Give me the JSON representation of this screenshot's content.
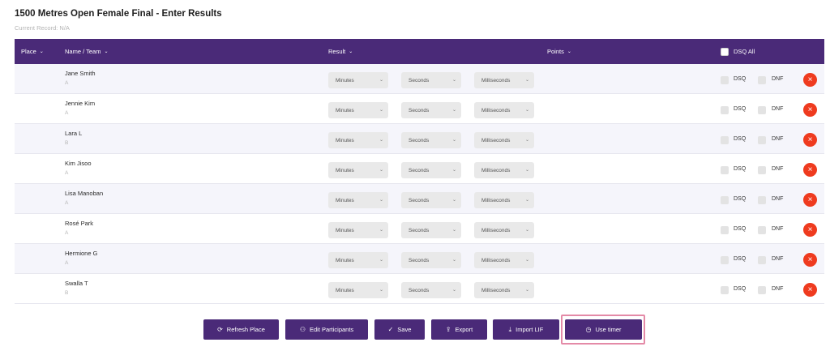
{
  "page": {
    "title": "1500 Metres Open Female Final - Enter Results",
    "subtitle": "Current Record: N/A"
  },
  "header": {
    "place": "Place",
    "name_team": "Name / Team",
    "result": "Result",
    "points": "Points",
    "dsq_all": "DSQ All",
    "caret": "⌄"
  },
  "select_labels": {
    "minutes": "Minutes",
    "seconds": "Seconds",
    "milliseconds": "Milliseconds",
    "chevron": "⌄"
  },
  "check_labels": {
    "dsq": "DSQ",
    "dnf": "DNF"
  },
  "remove_symbol": "×",
  "rows": [
    {
      "name": "Jane Smith",
      "team": "A"
    },
    {
      "name": "Jennie Kim",
      "team": "A"
    },
    {
      "name": "Lara L",
      "team": "B"
    },
    {
      "name": "Kim Jisoo",
      "team": "A"
    },
    {
      "name": "Lisa Manoban",
      "team": "A"
    },
    {
      "name": "Rosé Park",
      "team": "A"
    },
    {
      "name": "Hermione G",
      "team": "A"
    },
    {
      "name": "Swalla T",
      "team": "B"
    }
  ],
  "actions": {
    "refresh_place": "Refresh Place",
    "edit_participants": "Edit Participants",
    "save": "Save",
    "export": "Export",
    "import_lif": "Import LIF",
    "use_timer": "Use timer"
  },
  "icons": {
    "refresh": "⟳",
    "participants": "⚇",
    "check": "✓",
    "export": "⇪",
    "import": "⤓",
    "timer": "◷"
  },
  "colors": {
    "header_bg": "#4a2a78",
    "remove_red": "#ef3b1f",
    "highlight": "#e48aa7"
  }
}
